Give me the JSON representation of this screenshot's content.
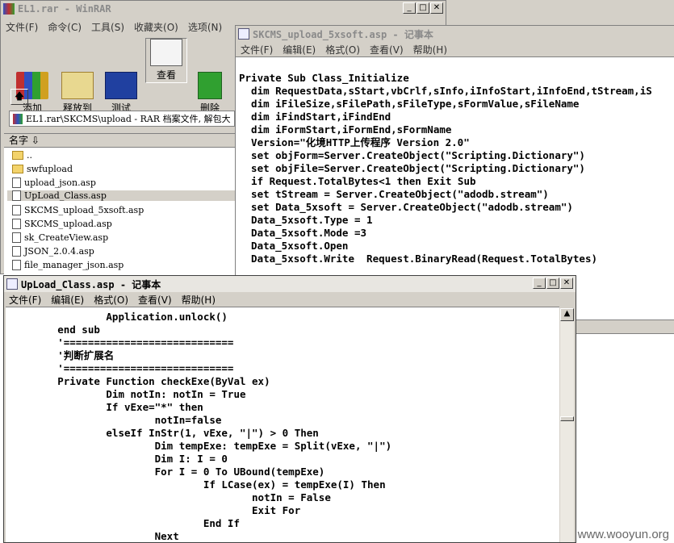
{
  "winrar": {
    "title": "EL1.rar - WinRAR",
    "menu": [
      "文件(F)",
      "命令(C)",
      "工具(S)",
      "收藏夹(O)",
      "选项(N)"
    ],
    "toolbar": [
      "添加",
      "释放到",
      "测试",
      "查看",
      "删除"
    ],
    "path": "EL1.rar\\SKCMS\\upload - RAR 档案文件, 解包大",
    "column_name": "名字",
    "files": [
      "..",
      "swfupload",
      "upload_json.asp",
      "UpLoad_Class.asp",
      "SKCMS_upload_5xsoft.asp",
      "SKCMS_upload.asp",
      "sk_CreateView.asp",
      "JSON_2.0.4.asp",
      "file_manager_json.asp"
    ]
  },
  "notepad1": {
    "title": "SKCMS_upload_5xsoft.asp - 记事本",
    "menu": [
      "文件(F)",
      "编辑(E)",
      "格式(O)",
      "查看(V)",
      "帮助(H)"
    ],
    "lines": [
      "",
      "Private Sub Class_Initialize",
      "  dim RequestData,sStart,vbCrlf,sInfo,iInfoStart,iInfoEnd,tStream,iS",
      "  dim iFileSize,sFilePath,sFileType,sFormValue,sFileName",
      "  dim iFindStart,iFindEnd",
      "  dim iFormStart,iFormEnd,sFormName",
      "  Version=\"化境HTTP上传程序 Version 2.0\"",
      "  set objForm=Server.CreateObject(\"Scripting.Dictionary\")",
      "  set objFile=Server.CreateObject(\"Scripting.Dictionary\")",
      "  if Request.TotalBytes<1 then Exit Sub",
      "  set tStream = Server.CreateObject(\"adodb.stream\")",
      "  set Data_5xsoft = Server.CreateObject(\"adodb.stream\")",
      "  Data_5xsoft.Type = 1",
      "  Data_5xsoft.Mode =3",
      "  Data_5xsoft.Open",
      "  Data_5xsoft.Write  Request.BinaryRead(Request.TotalBytes)"
    ]
  },
  "notepad2": {
    "title": "UpLoad_Class.asp - 记事本",
    "menu": [
      "文件(F)",
      "编辑(E)",
      "格式(O)",
      "查看(V)",
      "帮助(H)"
    ],
    "lines": [
      "                Application.unlock()",
      "        end sub",
      "        '============================",
      "        '判断扩展名",
      "        '============================",
      "        Private Function checkExe(ByVal ex)",
      "                Dim notIn: notIn = True",
      "                If vExe=\"*\" then",
      "                        notIn=false",
      "                elseIf InStr(1, vExe, \"|\") > 0 Then",
      "                        Dim tempExe: tempExe = Split(vExe, \"|\")",
      "                        Dim I: I = 0",
      "                        For I = 0 To UBound(tempExe)",
      "                                If LCase(ex) = tempExe(I) Then",
      "                                        notIn = False",
      "                                        Exit For",
      "                                End If",
      "                        Next"
    ]
  },
  "watermark": "www.wooyun.org"
}
